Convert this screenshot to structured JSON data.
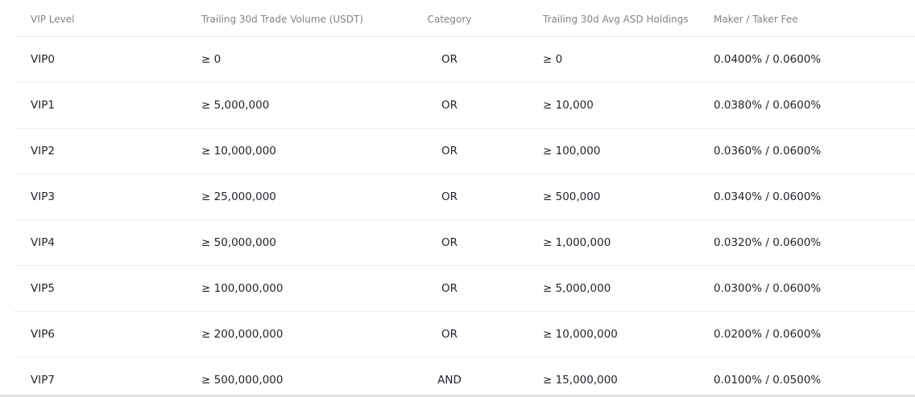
{
  "headers": {
    "vip_level": "VIP Level",
    "volume": "Trailing 30d Trade Volume (USDT)",
    "category": "Category",
    "holdings": "Trailing 30d Avg ASD Holdings",
    "fee": "Maker / Taker Fee"
  },
  "rows": [
    {
      "level": "VIP0",
      "volume": "≥ 0",
      "category": "OR",
      "holdings": "≥ 0",
      "fee": "0.0400% / 0.0600%"
    },
    {
      "level": "VIP1",
      "volume": "≥ 5,000,000",
      "category": "OR",
      "holdings": "≥ 10,000",
      "fee": "0.0380% / 0.0600%"
    },
    {
      "level": "VIP2",
      "volume": "≥ 10,000,000",
      "category": "OR",
      "holdings": "≥ 100,000",
      "fee": "0.0360% / 0.0600%"
    },
    {
      "level": "VIP3",
      "volume": "≥ 25,000,000",
      "category": "OR",
      "holdings": "≥ 500,000",
      "fee": "0.0340% / 0.0600%"
    },
    {
      "level": "VIP4",
      "volume": "≥ 50,000,000",
      "category": "OR",
      "holdings": "≥ 1,000,000",
      "fee": "0.0320% / 0.0600%"
    },
    {
      "level": "VIP5",
      "volume": "≥ 100,000,000",
      "category": "OR",
      "holdings": "≥ 5,000,000",
      "fee": "0.0300% / 0.0600%"
    },
    {
      "level": "VIP6",
      "volume": "≥ 200,000,000",
      "category": "OR",
      "holdings": "≥ 10,000,000",
      "fee": "0.0200% / 0.0600%"
    },
    {
      "level": "VIP7",
      "volume": "≥ 500,000,000",
      "category": "AND",
      "holdings": "≥ 15,000,000",
      "fee": "0.0100% / 0.0500%"
    }
  ]
}
